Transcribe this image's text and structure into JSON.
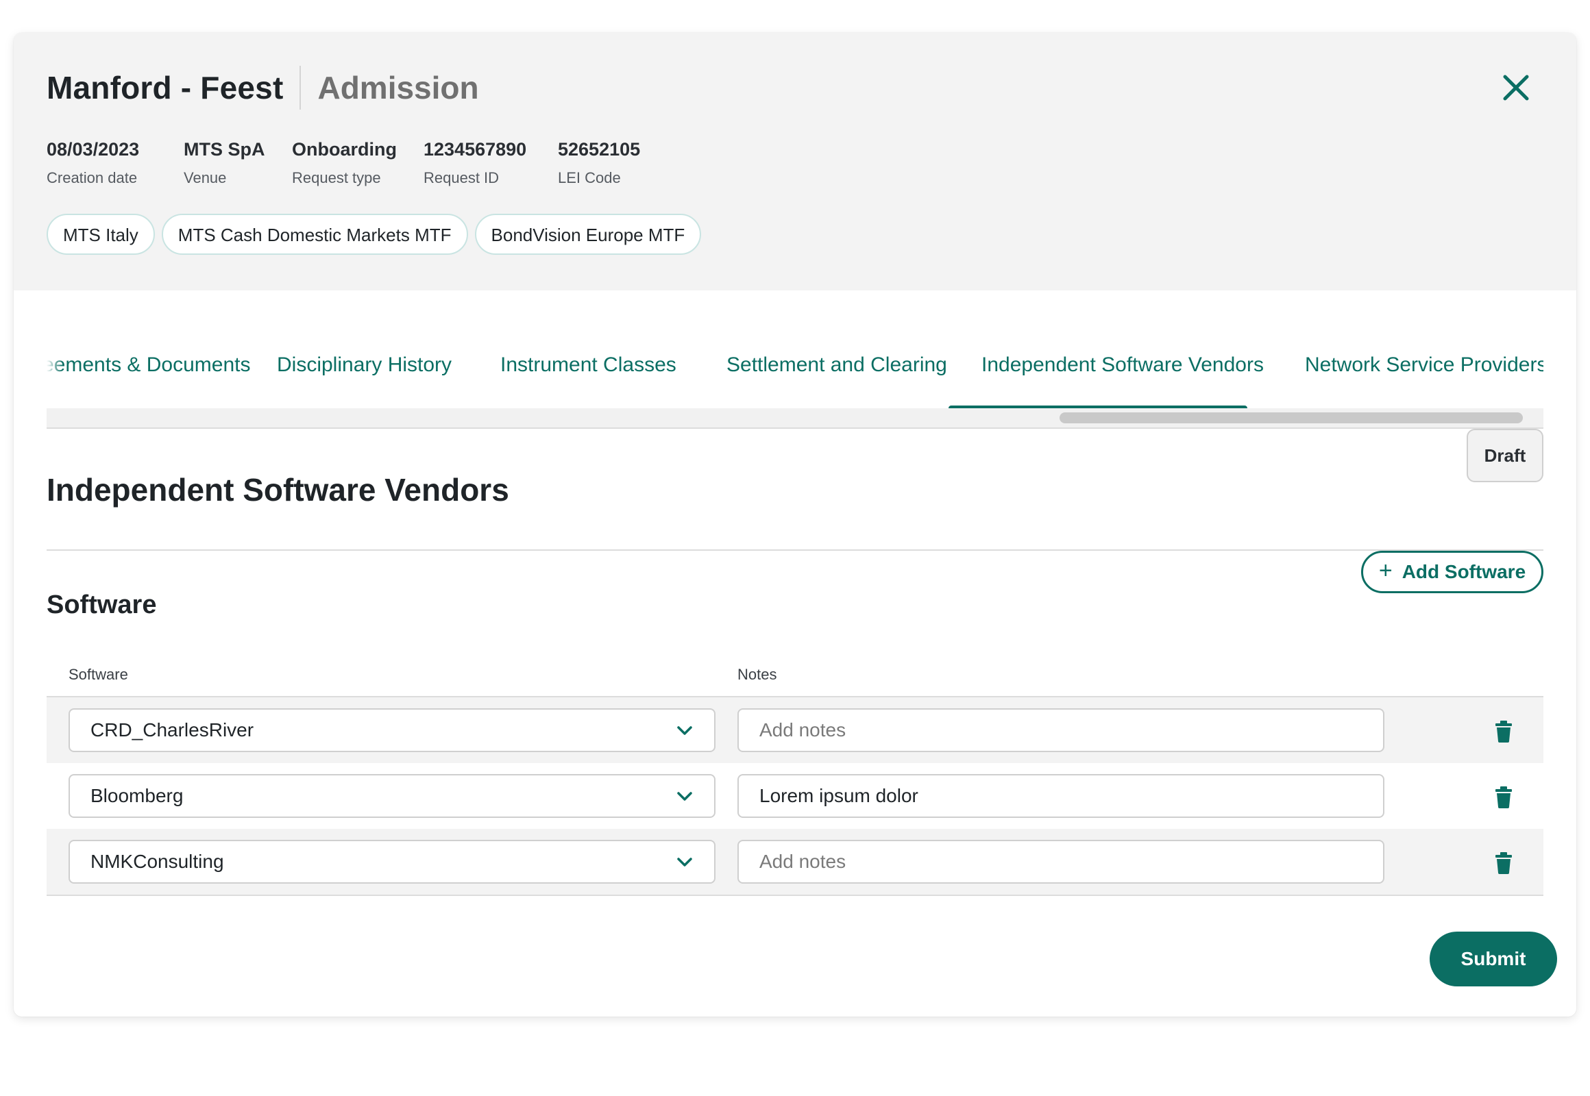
{
  "header": {
    "title": "Manford - Feest",
    "subtitle": "Admission",
    "meta": [
      {
        "value": "08/03/2023",
        "label": "Creation date"
      },
      {
        "value": "MTS SpA",
        "label": "Venue"
      },
      {
        "value": "Onboarding",
        "label": "Request type"
      },
      {
        "value": "1234567890",
        "label": "Request ID"
      },
      {
        "value": "52652105",
        "label": "LEI Code"
      }
    ],
    "chips": [
      "MTS Italy",
      "MTS Cash Domestic Markets MTF",
      "BondVision Europe MTF"
    ]
  },
  "tabs": [
    {
      "label": "eements & Documents",
      "active": false
    },
    {
      "label": "Disciplinary History",
      "active": false
    },
    {
      "label": "Instrument Classes",
      "active": false
    },
    {
      "label": "Settlement and Clearing",
      "active": false
    },
    {
      "label": "Independent Software Vendors",
      "active": true
    },
    {
      "label": "Network Service Providers",
      "active": false
    }
  ],
  "section": {
    "title": "Independent Software Vendors",
    "status_badge": "Draft",
    "subsection_title": "Software",
    "add_button_label": "Add Software",
    "columns": {
      "software": "Software",
      "notes": "Notes"
    },
    "rows": [
      {
        "software": "CRD_CharlesRiver",
        "notes_value": "",
        "notes_placeholder": "Add notes"
      },
      {
        "software": "Bloomberg",
        "notes_value": "Lorem ipsum dolor",
        "notes_placeholder": "Add notes"
      },
      {
        "software": "NMKConsulting",
        "notes_value": "",
        "notes_placeholder": "Add notes"
      }
    ]
  },
  "footer": {
    "submit_label": "Submit"
  },
  "colors": {
    "accent": "#0b6e63",
    "header_bg": "#f3f3f3",
    "chip_border": "#c9e4e2"
  },
  "icons": {
    "close": "close-icon",
    "add": "plus-icon",
    "dropdown": "chevron-down-icon",
    "delete": "trash-icon"
  }
}
